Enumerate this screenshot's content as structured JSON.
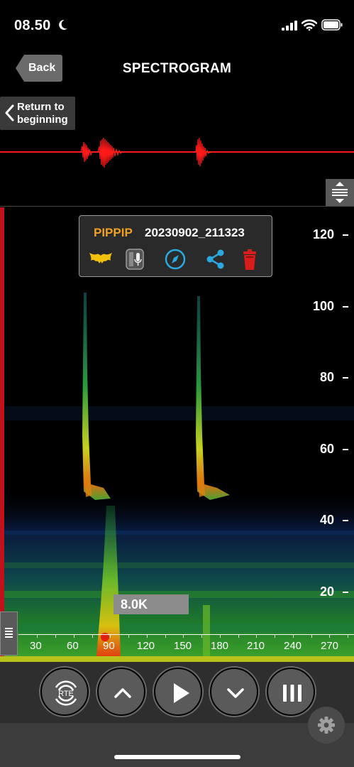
{
  "status_bar": {
    "time": "08.50"
  },
  "nav": {
    "back_label": "Back",
    "title": "SPECTROGRAM",
    "return_label_line1": "Return to",
    "return_label_line2": "beginning"
  },
  "recording": {
    "species": "PIPPIP",
    "file_name": "20230902_211323"
  },
  "frequency_readout": "8.0K",
  "y_axis": {
    "labels": [
      "120",
      "100",
      "80",
      "60",
      "40",
      "20"
    ]
  },
  "x_axis": {
    "labels": [
      "30",
      "60",
      "90",
      "120",
      "150",
      "180",
      "210",
      "240",
      "270"
    ]
  },
  "icons": {
    "bat": "bat-icon",
    "recorder": "recorder-icon",
    "compass": "compass-icon",
    "share": "share-icon",
    "trash": "trash-icon",
    "rte": "rte-icon",
    "up": "chevron-up-icon",
    "play": "play-icon",
    "down": "chevron-down-icon",
    "pause": "pause-icon",
    "settings": "gear-icon"
  },
  "controls": {
    "rte_label": "RTE"
  },
  "colors": {
    "species": "#f0a020",
    "waveform": "#ff1a1a",
    "accent_blue": "#2ba8e0",
    "trash": "#d91c1c"
  }
}
